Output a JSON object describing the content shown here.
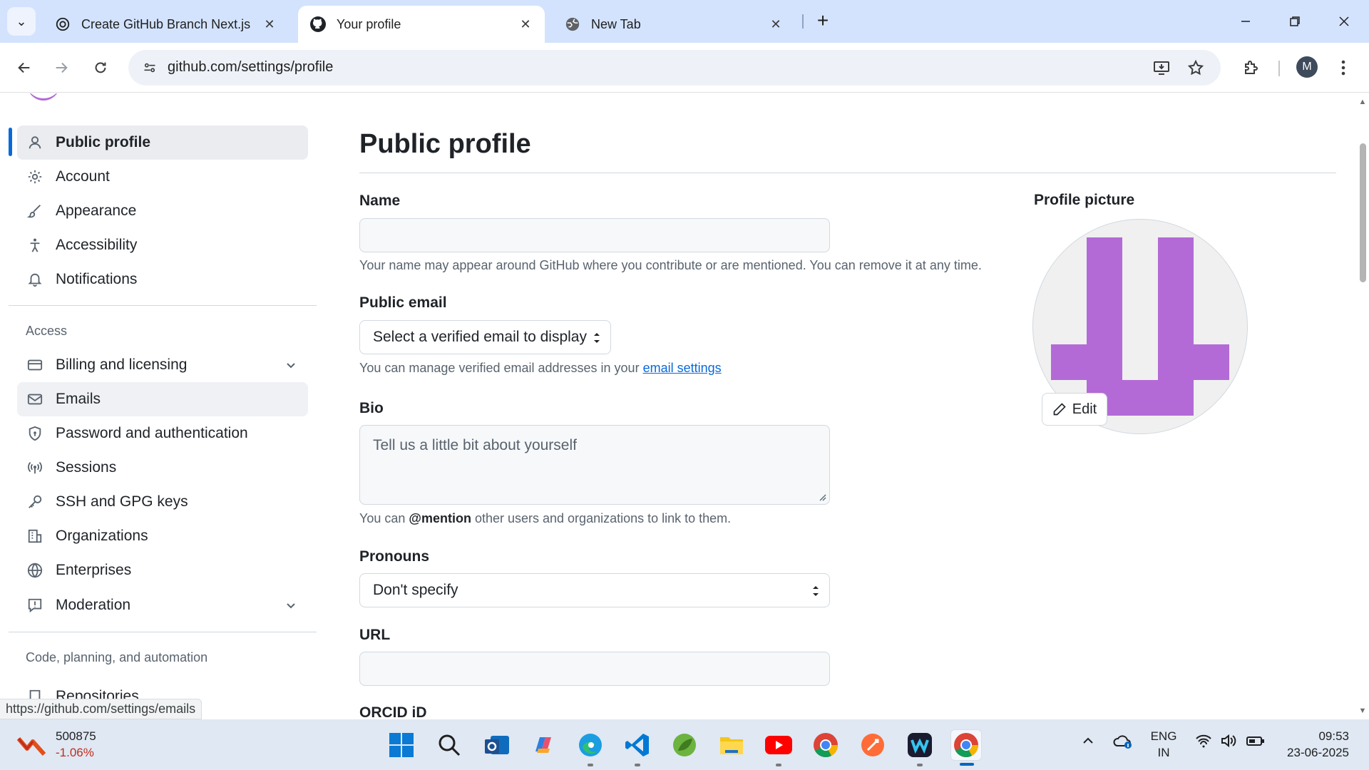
{
  "browser": {
    "tabs": [
      {
        "label": "Create GitHub Branch Next.js",
        "icon": "openai-icon"
      },
      {
        "label": "Your profile",
        "icon": "github-icon",
        "active": true
      },
      {
        "label": "New Tab",
        "icon": "globe-icon"
      }
    ],
    "url": "github.com/settings/profile",
    "profile_initial": "M",
    "status_url": "https://github.com/settings/emails"
  },
  "sidebar": {
    "items": [
      {
        "label": "Public profile",
        "icon": "person-icon"
      },
      {
        "label": "Account",
        "icon": "gear-icon"
      },
      {
        "label": "Appearance",
        "icon": "paintbrush-icon"
      },
      {
        "label": "Accessibility",
        "icon": "accessibility-icon"
      },
      {
        "label": "Notifications",
        "icon": "bell-icon"
      }
    ],
    "access_heading": "Access",
    "access_items": [
      {
        "label": "Billing and licensing",
        "icon": "credit-card-icon"
      },
      {
        "label": "Emails",
        "icon": "mail-icon"
      },
      {
        "label": "Password and authentication",
        "icon": "shield-lock-icon"
      },
      {
        "label": "Sessions",
        "icon": "broadcast-icon"
      },
      {
        "label": "SSH and GPG keys",
        "icon": "key-icon"
      },
      {
        "label": "Organizations",
        "icon": "organization-icon"
      },
      {
        "label": "Enterprises",
        "icon": "globe-icon"
      },
      {
        "label": "Moderation",
        "icon": "report-icon"
      }
    ],
    "code_heading": "Code, planning, and automation",
    "code_items": [
      {
        "label": "Repositories",
        "icon": "repo-icon"
      }
    ]
  },
  "profile": {
    "title": "Public profile",
    "name": {
      "label": "Name",
      "value": "",
      "hint": "Your name may appear around GitHub where you contribute or are mentioned. You can remove it at any time."
    },
    "email": {
      "label": "Public email",
      "selected": "Select a verified email to display",
      "hint_prefix": "You can manage verified email addresses in your ",
      "hint_link": "email settings"
    },
    "bio": {
      "label": "Bio",
      "placeholder": "Tell us a little bit about yourself",
      "hint_prefix": "You can ",
      "hint_mention": "@mention",
      "hint_suffix": " other users and organizations to link to them."
    },
    "pronouns": {
      "label": "Pronouns",
      "selected": "Don't specify"
    },
    "url": {
      "label": "URL",
      "value": ""
    },
    "orcid": {
      "label": "ORCID iD"
    },
    "picture": {
      "label": "Profile picture",
      "edit_label": "Edit"
    }
  },
  "taskbar": {
    "stock_value": "500875",
    "stock_change": "-1.06%",
    "language": "ENG",
    "region": "IN",
    "time": "09:53",
    "date": "23-06-2025"
  },
  "colors": {
    "accent": "#0969da",
    "identicon": "#b36ad6",
    "stock_negative": "#c42b1c"
  }
}
